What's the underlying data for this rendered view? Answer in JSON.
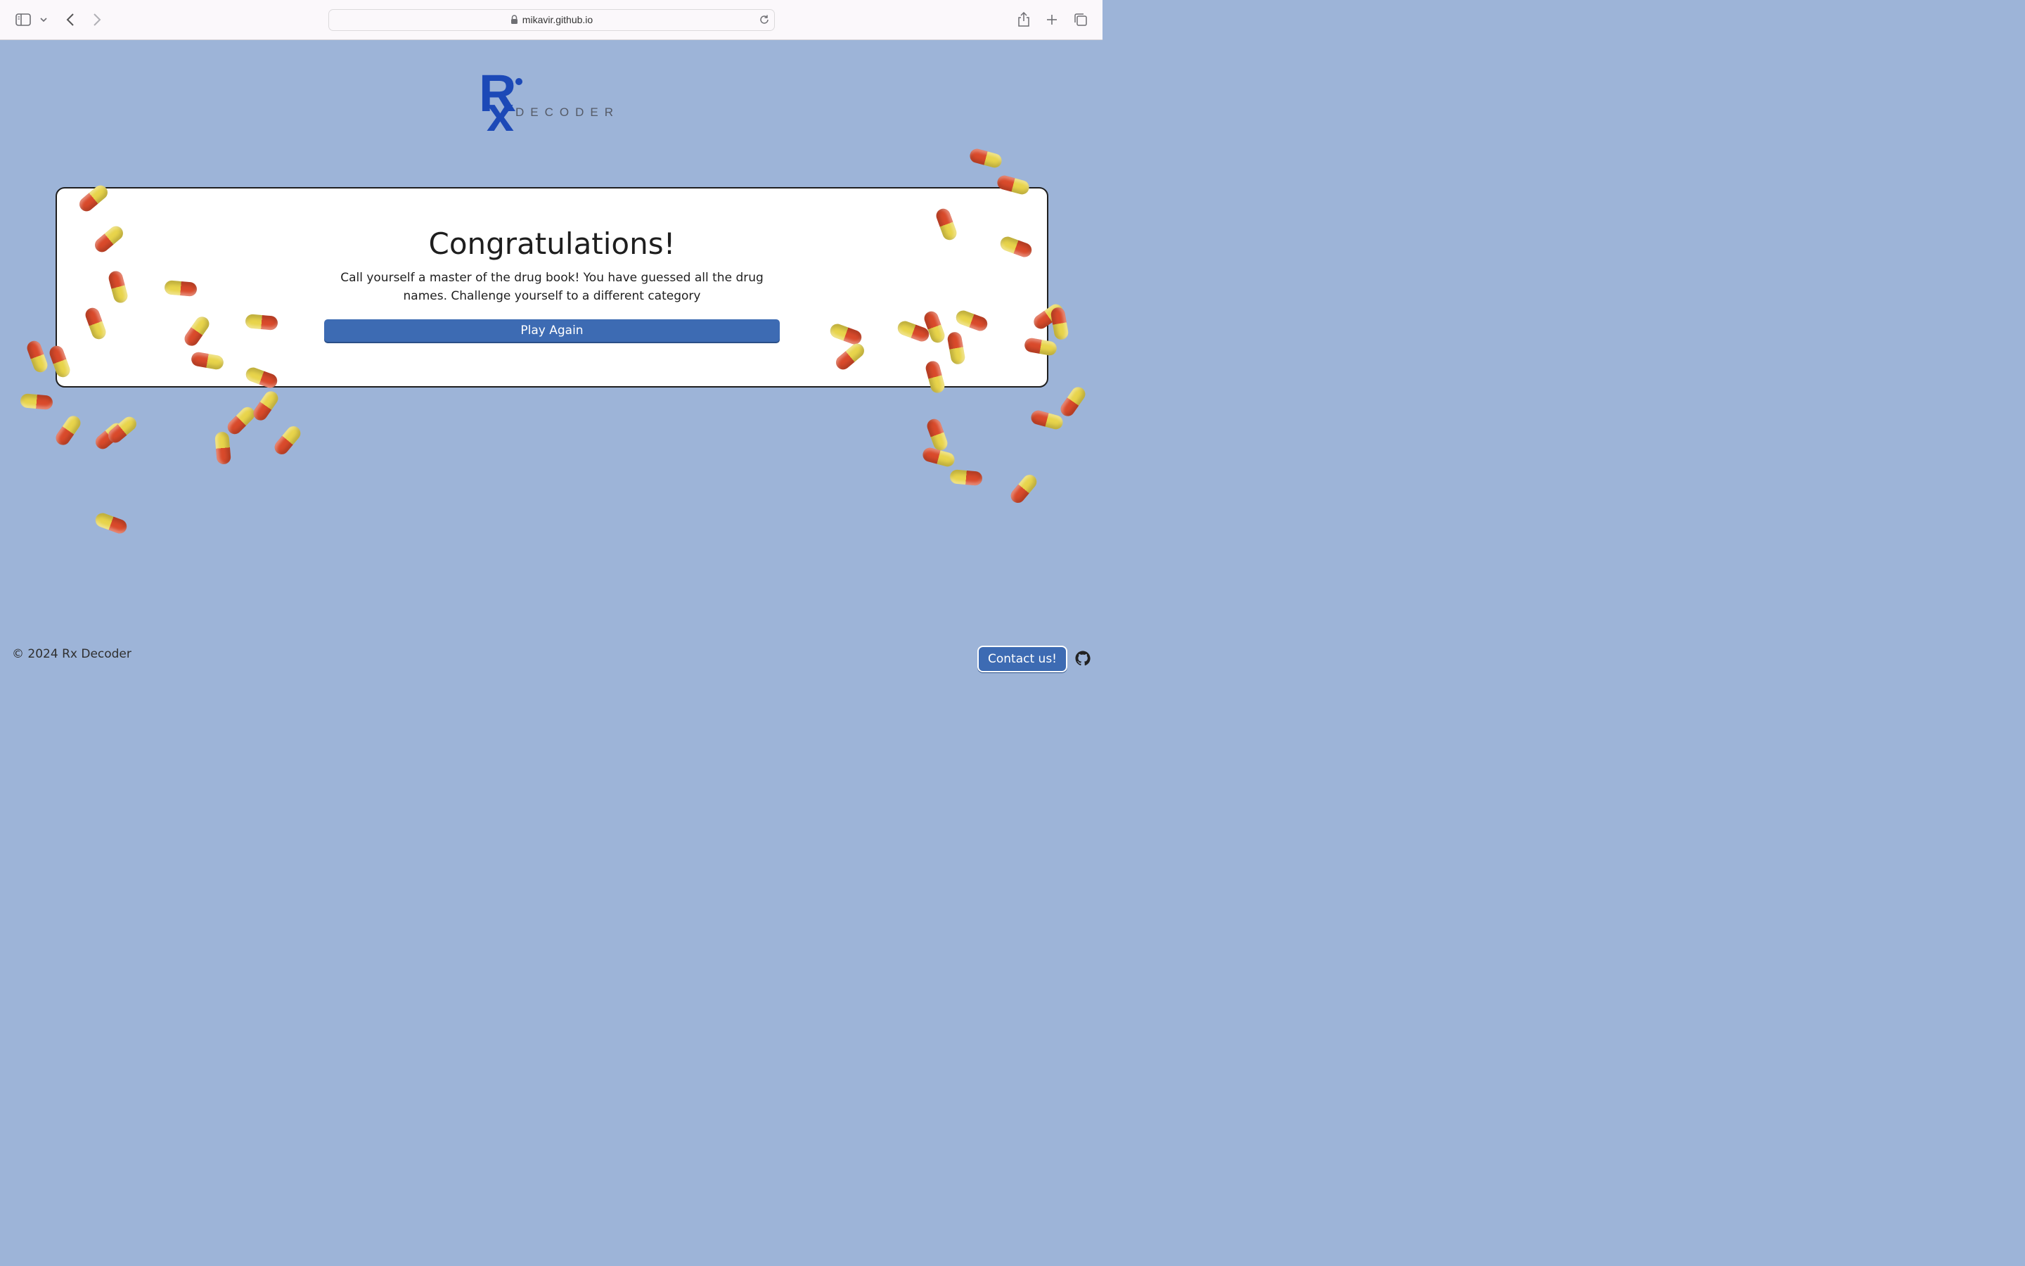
{
  "browser": {
    "url": "mikavir.github.io"
  },
  "logo": {
    "rx": "R",
    "x": "x",
    "decoder": "DECODER"
  },
  "card": {
    "title": "Congratulations!",
    "message": "Call yourself a master of the drug book! You have guessed all the drug names. Challenge yourself to a different category",
    "play_again_label": "Play Again"
  },
  "footer": {
    "copyright": "© 2024 Rx Decoder",
    "contact_label": "Contact us!"
  },
  "colors": {
    "background": "#9db4d8",
    "brand_blue": "#1c49b7",
    "button_blue": "#3d6bb3",
    "pill_red": "#d94a2b",
    "pill_yellow": "#e8d44b"
  },
  "icons": [
    "sidebar-icon",
    "chevron-down-icon",
    "back-icon",
    "forward-icon",
    "lock-icon",
    "reload-icon",
    "share-icon",
    "new-tab-icon",
    "tab-overview-icon",
    "github-icon",
    "pill-icon"
  ]
}
